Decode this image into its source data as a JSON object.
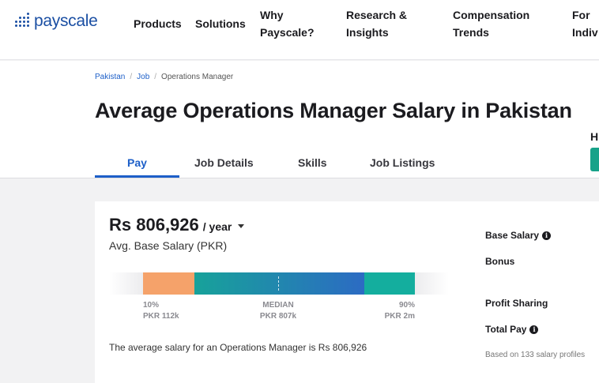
{
  "nav": {
    "logo_text": "payscale",
    "items": [
      {
        "line1": "Products",
        "line2": ""
      },
      {
        "line1": "Solutions",
        "line2": ""
      },
      {
        "line1": "Why",
        "line2": "Payscale?"
      },
      {
        "line1": "Research &",
        "line2": "Insights"
      },
      {
        "line1": "Compensation",
        "line2": "Trends"
      },
      {
        "line1": "For",
        "line2": "Indiv"
      }
    ]
  },
  "breadcrumb": {
    "items": [
      "Pakistan",
      "Job",
      "Operations Manager"
    ],
    "separator": "/"
  },
  "page_title": "Average Operations Manager Salary in Pakistan",
  "tabs": [
    "Pay",
    "Job Details",
    "Skills",
    "Job Listings"
  ],
  "active_tab": "Pay",
  "side_heading": "H",
  "salary": {
    "value": "Rs 806,926",
    "unit": "/ year",
    "label": "Avg. Base Salary (PKR)",
    "summary": "The average salary for an Operations Manager is Rs 806,926"
  },
  "distribution": {
    "low": {
      "pct": "10%",
      "value": "PKR 112k"
    },
    "median": {
      "pct": "MEDIAN",
      "value": "PKR 807k"
    },
    "high": {
      "pct": "90%",
      "value": "PKR 2m"
    }
  },
  "breakdown": {
    "base_salary": "Base Salary",
    "bonus": "Bonus",
    "profit_sharing": "Profit Sharing",
    "total_pay": "Total Pay",
    "based_on": "Based on 133 salary profiles"
  },
  "colors": {
    "brand_blue": "#1b4fa3",
    "accent_blue": "#1d5fc8",
    "orange": "#f5a26a",
    "teal": "#14ae9e"
  },
  "icons": {
    "info": "info-icon",
    "caret": "chevron-down-icon",
    "logo": "payscale-logo-dots-icon"
  }
}
